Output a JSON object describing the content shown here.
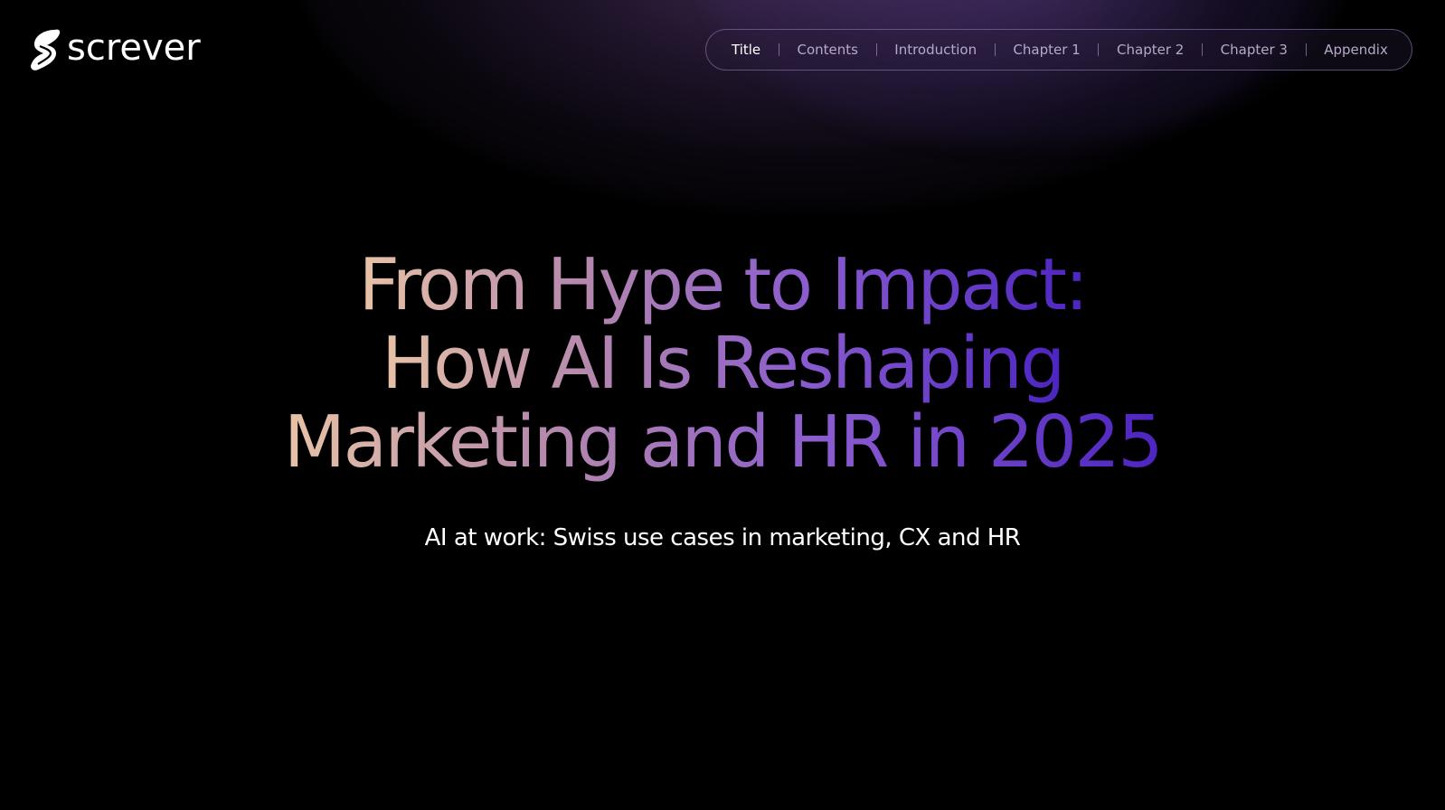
{
  "brand": {
    "name": "screver",
    "logo_icon": "s-logo-icon"
  },
  "nav": {
    "items": [
      {
        "label": "Title",
        "active": true
      },
      {
        "label": "Contents",
        "active": false
      },
      {
        "label": "Introduction",
        "active": false
      },
      {
        "label": "Chapter 1",
        "active": false
      },
      {
        "label": "Chapter 2",
        "active": false
      },
      {
        "label": "Chapter 3",
        "active": false
      },
      {
        "label": "Appendix",
        "active": false
      }
    ]
  },
  "hero": {
    "title_lines": [
      "From Hype to Impact:",
      "How AI Is Reshaping",
      "Marketing and HR in 2025"
    ],
    "subtitle": "AI at work: Swiss use cases in marketing, CX and HR"
  },
  "colors": {
    "background": "#000000",
    "gradient_start": "#e8c3a6",
    "gradient_mid": "#8a5bcf",
    "gradient_end": "#4c24c0",
    "nav_text": "#b6aac8",
    "nav_active": "#ffffff"
  }
}
